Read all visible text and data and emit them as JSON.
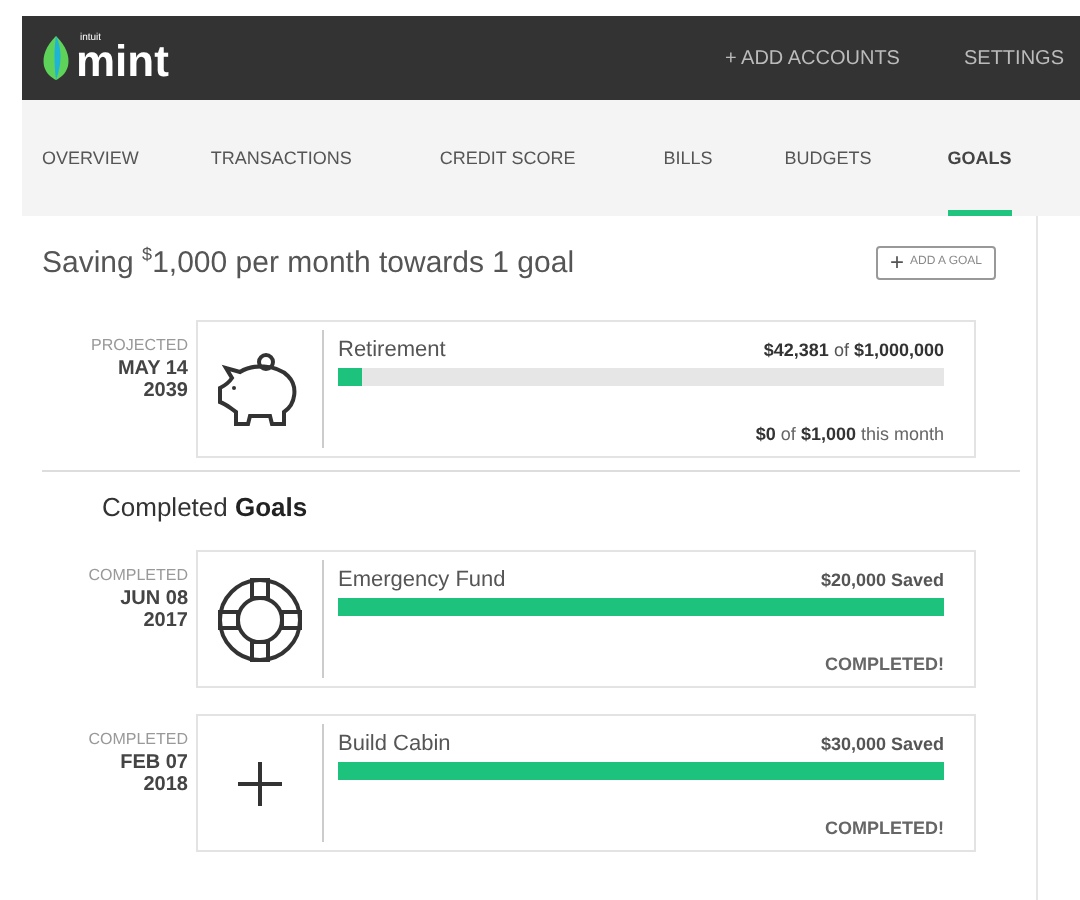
{
  "header": {
    "logo_small": "intuit",
    "logo": "mint",
    "links": [
      "+ ADD ACCOUNTS",
      "SETTINGS"
    ]
  },
  "tabs": [
    {
      "label": "OVERVIEW",
      "selected": false
    },
    {
      "label": "TRANSACTIONS",
      "selected": false
    },
    {
      "label": "CREDIT SCORE",
      "selected": false
    },
    {
      "label": "BILLS",
      "selected": false
    },
    {
      "label": "BUDGETS",
      "selected": false
    },
    {
      "label": "GOALS",
      "selected": true
    }
  ],
  "summary": "Saving $^{$}$1,000 per month towards 1 goal",
  "add_goal": {
    "icon": "+",
    "label": "ADD A GOAL"
  },
  "active_goals": [
    {
      "status": "PROJECTED",
      "date": "MAY 14",
      "year": "2039",
      "kind": "piggy",
      "name": "Retirement",
      "amount": "**$42,381** of **$1,000,000**",
      "level": 0.04,
      "footer": "**$0** of **$1,000** this month"
    }
  ],
  "completed_heading": "Completed **Goals**",
  "completed_goals": [
    {
      "status": "COMPLETED",
      "date": "JUN 08",
      "year": "2017",
      "kind": "lifebuoy",
      "name": "Emergency Fund",
      "amount": "$20,000 Saved",
      "level": 1,
      "footer": "COMPLETED!"
    },
    {
      "status": "COMPLETED",
      "date": "FEB 07",
      "year": "2018",
      "kind": "plus",
      "name": "Build Cabin",
      "amount": "$30,000 Saved",
      "level": 1,
      "footer": "COMPLETED!"
    }
  ]
}
